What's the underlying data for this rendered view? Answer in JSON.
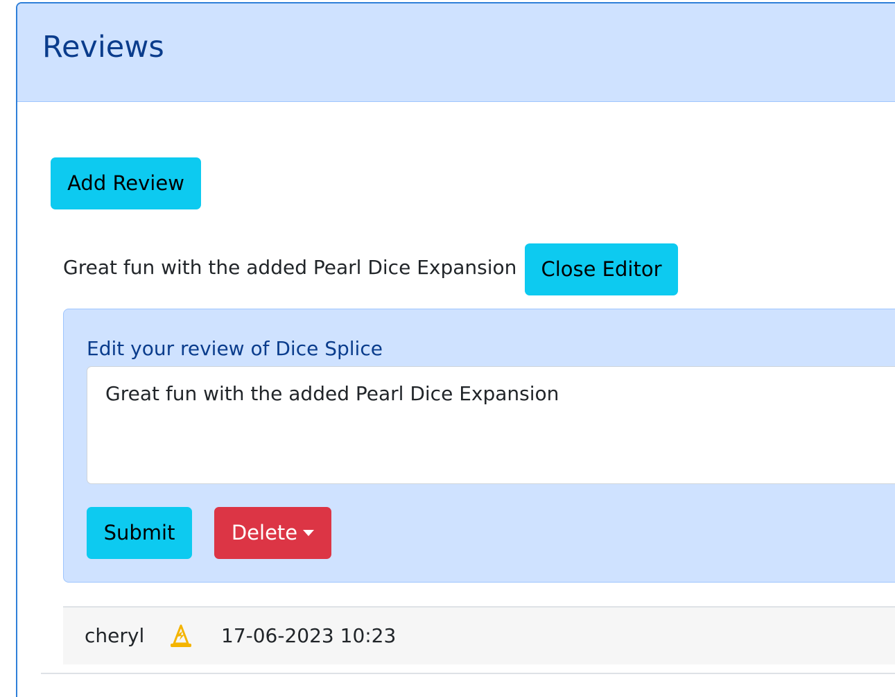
{
  "header": {
    "title": "Reviews"
  },
  "actions": {
    "add_review_label": "Add Review",
    "close_editor_label": "Close Editor"
  },
  "review": {
    "text": "Great fun with the added Pearl Dice Expansion"
  },
  "editor": {
    "label": "Edit your review of Dice Splice",
    "textarea_value": "Great fun with the added Pearl Dice Expansion",
    "submit_label": "Submit",
    "delete_label": "Delete"
  },
  "meta": {
    "username": "cheryl",
    "user_icon": "wizard-hat-icon",
    "timestamp": "17-06-2023 10:23"
  },
  "colors": {
    "header_bg": "#cfe2ff",
    "title_color": "#0a3c8c",
    "info_button": "#0dcaf0",
    "danger_button": "#dc3545",
    "icon_color": "#f4b400"
  }
}
